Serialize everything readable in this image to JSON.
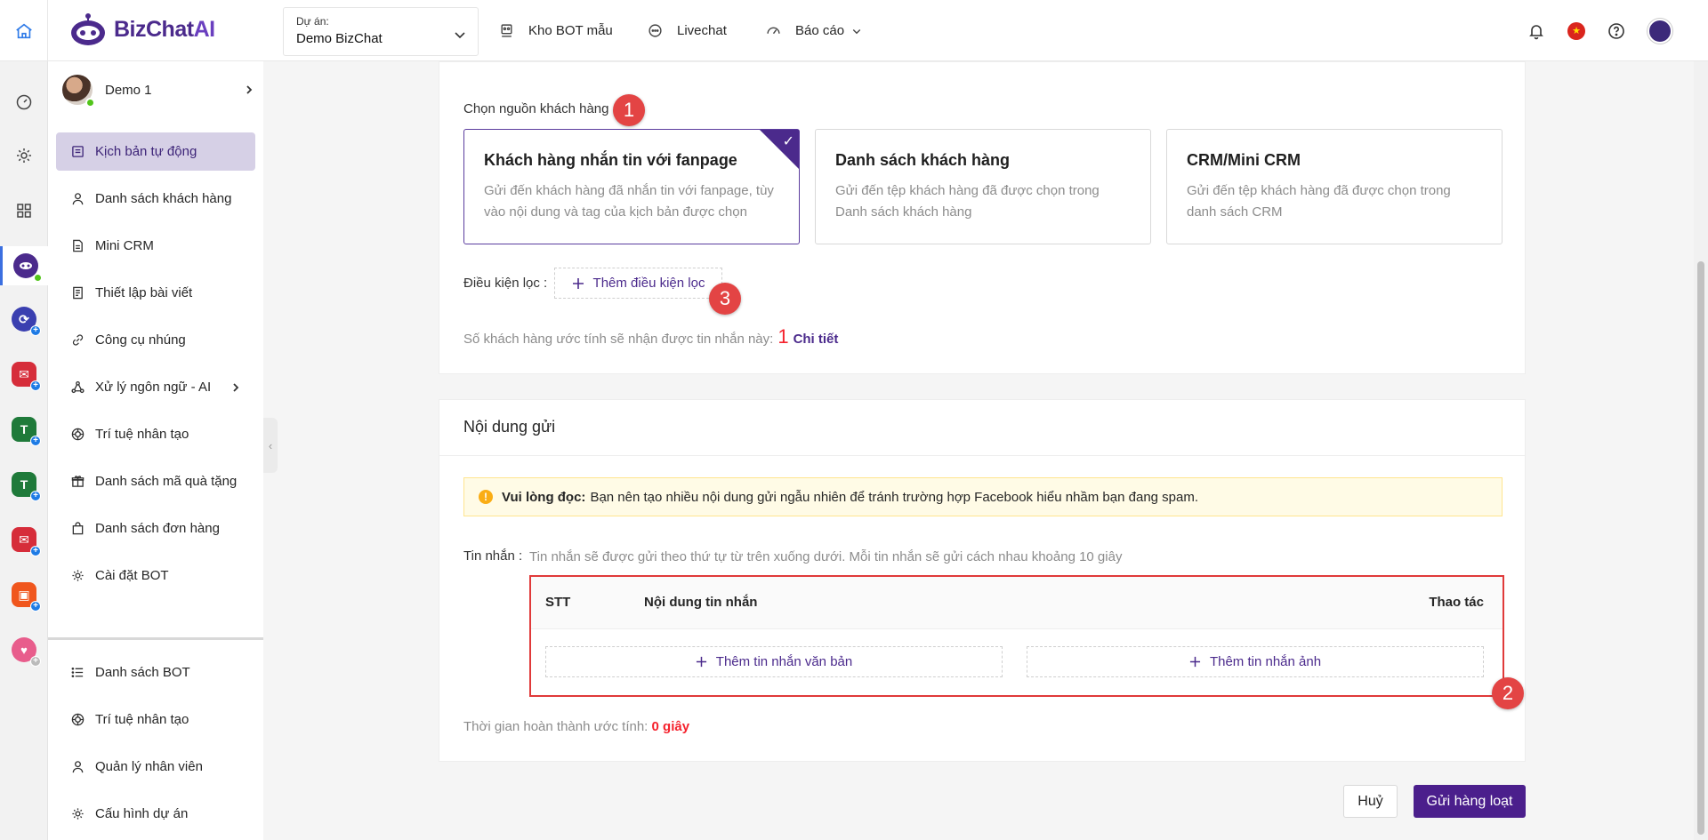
{
  "header": {
    "brand_main": "BizChat",
    "brand_ai": "AI",
    "project_label": "Dự án:",
    "project_value": "Demo BizChat",
    "nav": [
      "Kho BOT mẫu",
      "Livechat",
      "Báo cáo"
    ]
  },
  "sidebar": {
    "user_name": "Demo 1",
    "menu": [
      "Kịch bản tự động",
      "Danh sách khách hàng",
      "Mini CRM",
      "Thiết lập bài viết",
      "Công cụ nhúng",
      "Xử lý ngôn ngữ - AI",
      "Trí tuệ nhân tạo",
      "Danh sách mã quà tặng",
      "Danh sách đơn hàng",
      "Cài đặt BOT"
    ],
    "bottom_menu": [
      "Danh sách BOT",
      "Trí tuệ nhân tạo",
      "Quản lý nhân viên",
      "Cấu hình dự án"
    ]
  },
  "source": {
    "label": "Chọn nguồn khách hàng",
    "cards": [
      {
        "title": "Khách hàng nhắn tin với fanpage",
        "desc1": "Gửi đến khách hàng đã nhắn tin với fanpage, tùy",
        "desc2": "vào nội dung và tag của kịch bản được chọn"
      },
      {
        "title": "Danh sách khách hàng",
        "desc1": "Gửi đến tệp khách hàng đã được chọn trong",
        "desc2": "Danh sách khách hàng"
      },
      {
        "title": "CRM/Mini CRM",
        "desc1": "Gửi đến tệp khách hàng đã được chọn trong",
        "desc2": "danh sách CRM"
      }
    ],
    "filter_label": "Điều kiện lọc :",
    "add_filter": "Thêm điều kiện lọc",
    "estimate_text": "Số khách hàng ước tính sẽ nhận được tin nhắn này:",
    "estimate_count": "1",
    "detail_link": "Chi tiết"
  },
  "content": {
    "title": "Nội dung gửi",
    "warn_bold": "Vui lòng đọc:",
    "warn_text": "Bạn nên tạo nhiều nội dung gửi ngẫu nhiên để tránh trường hợp Facebook hiểu nhầm bạn đang spam.",
    "msg_label": "Tin nhắn :",
    "msg_hint": "Tin nhắn sẽ được gửi theo thứ tự từ trên xuống dưới. Mỗi tin nhắn sẽ gửi cách nhau khoảng 10 giây",
    "col_stt": "STT",
    "col_content": "Nội dung tin nhắn",
    "col_action": "Thao tác",
    "add_text_msg": "Thêm tin nhắn văn bản",
    "add_image_msg": "Thêm tin nhắn ảnh",
    "time_label": "Thời gian hoàn thành ước tính:",
    "time_value": "0 giây"
  },
  "badges": [
    "1",
    "2",
    "3"
  ],
  "actions": {
    "cancel": "Huỷ",
    "send": "Gửi hàng loạt"
  },
  "colors": {
    "brand": "#4b2a8c",
    "badge": "#e34444",
    "warn_bg": "#fffbe6",
    "accent_red": "#f5222d"
  }
}
